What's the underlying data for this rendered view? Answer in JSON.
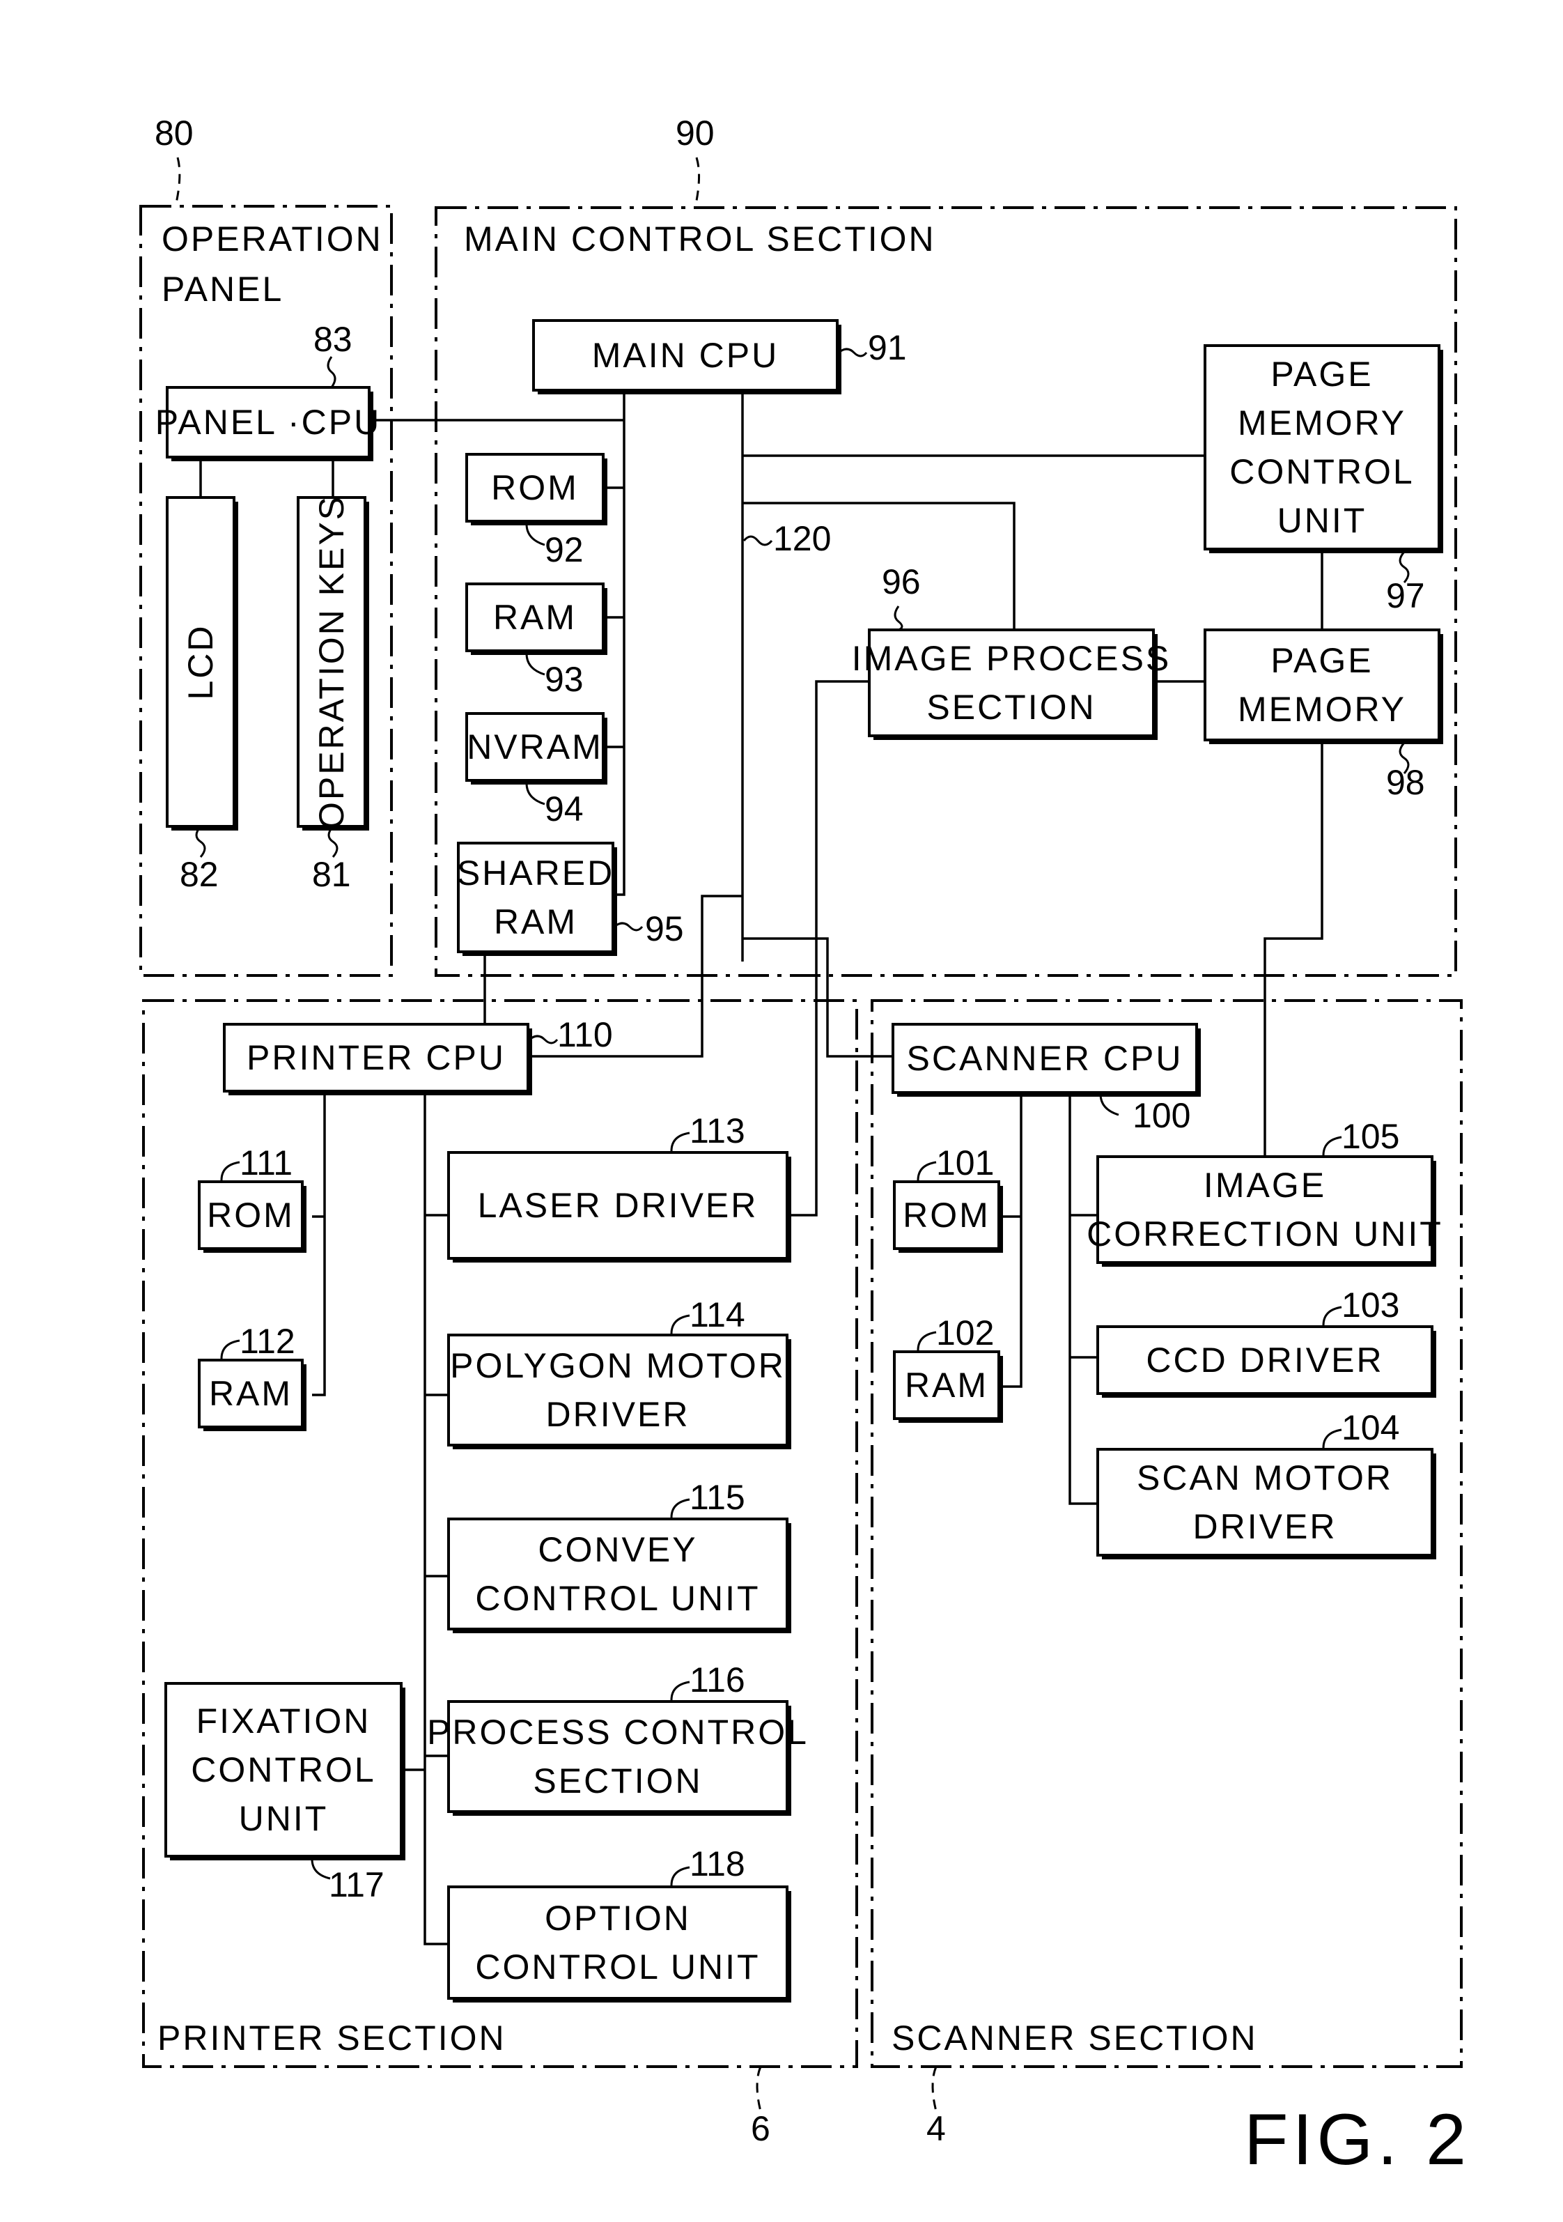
{
  "figure": {
    "title": "FIG. 2"
  },
  "sections": {
    "operation_panel": {
      "ref": "80",
      "title_lines": [
        "OPERATION",
        "PANEL"
      ]
    },
    "main_control": {
      "ref": "90",
      "title": "MAIN CONTROL SECTION"
    },
    "printer": {
      "ref": "6",
      "title": "PRINTER SECTION"
    },
    "scanner": {
      "ref": "4",
      "title": "SCANNER SECTION"
    }
  },
  "bus": {
    "ref": "120"
  },
  "blocks": [
    {
      "id": "panel-cpu",
      "ref": "83",
      "lines": [
        "PANEL ·CPU"
      ]
    },
    {
      "id": "lcd",
      "ref": "82",
      "lines": [
        "LCD"
      ],
      "vertical": true
    },
    {
      "id": "operation-keys",
      "ref": "81",
      "lines": [
        "OPERATION KEYS"
      ],
      "vertical": true
    },
    {
      "id": "main-cpu",
      "ref": "91",
      "lines": [
        "MAIN CPU"
      ]
    },
    {
      "id": "main-rom",
      "ref": "92",
      "lines": [
        "ROM"
      ]
    },
    {
      "id": "main-ram",
      "ref": "93",
      "lines": [
        "RAM"
      ]
    },
    {
      "id": "nvram",
      "ref": "94",
      "lines": [
        "NVRAM"
      ]
    },
    {
      "id": "shared-ram",
      "ref": "95",
      "lines": [
        "SHARED",
        "RAM"
      ]
    },
    {
      "id": "image-process-section",
      "ref": "96",
      "lines": [
        "IMAGE PROCESS",
        "SECTION"
      ]
    },
    {
      "id": "page-memory-control-unit",
      "ref": "97",
      "lines": [
        "PAGE",
        "MEMORY",
        "CONTROL",
        "UNIT"
      ]
    },
    {
      "id": "page-memory",
      "ref": "98",
      "lines": [
        "PAGE",
        "MEMORY"
      ]
    },
    {
      "id": "printer-cpu",
      "ref": "110",
      "lines": [
        "PRINTER CPU"
      ]
    },
    {
      "id": "printer-rom",
      "ref": "111",
      "lines": [
        "ROM"
      ]
    },
    {
      "id": "printer-ram",
      "ref": "112",
      "lines": [
        "RAM"
      ]
    },
    {
      "id": "laser-driver",
      "ref": "113",
      "lines": [
        "LASER DRIVER"
      ]
    },
    {
      "id": "polygon-motor-driver",
      "ref": "114",
      "lines": [
        "POLYGON MOTOR",
        "DRIVER"
      ]
    },
    {
      "id": "convey-control-unit",
      "ref": "115",
      "lines": [
        "CONVEY",
        "CONTROL UNIT"
      ]
    },
    {
      "id": "process-control-section",
      "ref": "116",
      "lines": [
        "PROCESS CONTROL",
        "SECTION"
      ]
    },
    {
      "id": "fixation-control-unit",
      "ref": "117",
      "lines": [
        "FIXATION",
        "CONTROL",
        "UNIT"
      ]
    },
    {
      "id": "option-control-unit",
      "ref": "118",
      "lines": [
        "OPTION",
        "CONTROL UNIT"
      ]
    },
    {
      "id": "scanner-cpu",
      "ref": "100",
      "lines": [
        "SCANNER CPU"
      ]
    },
    {
      "id": "scanner-rom",
      "ref": "101",
      "lines": [
        "ROM"
      ]
    },
    {
      "id": "scanner-ram",
      "ref": "102",
      "lines": [
        "RAM"
      ]
    },
    {
      "id": "ccd-driver",
      "ref": "103",
      "lines": [
        "CCD DRIVER"
      ]
    },
    {
      "id": "scan-motor-driver",
      "ref": "104",
      "lines": [
        "SCAN MOTOR",
        "DRIVER"
      ]
    },
    {
      "id": "image-correction-unit",
      "ref": "105",
      "lines": [
        "IMAGE",
        "CORRECTION UNIT"
      ]
    }
  ]
}
